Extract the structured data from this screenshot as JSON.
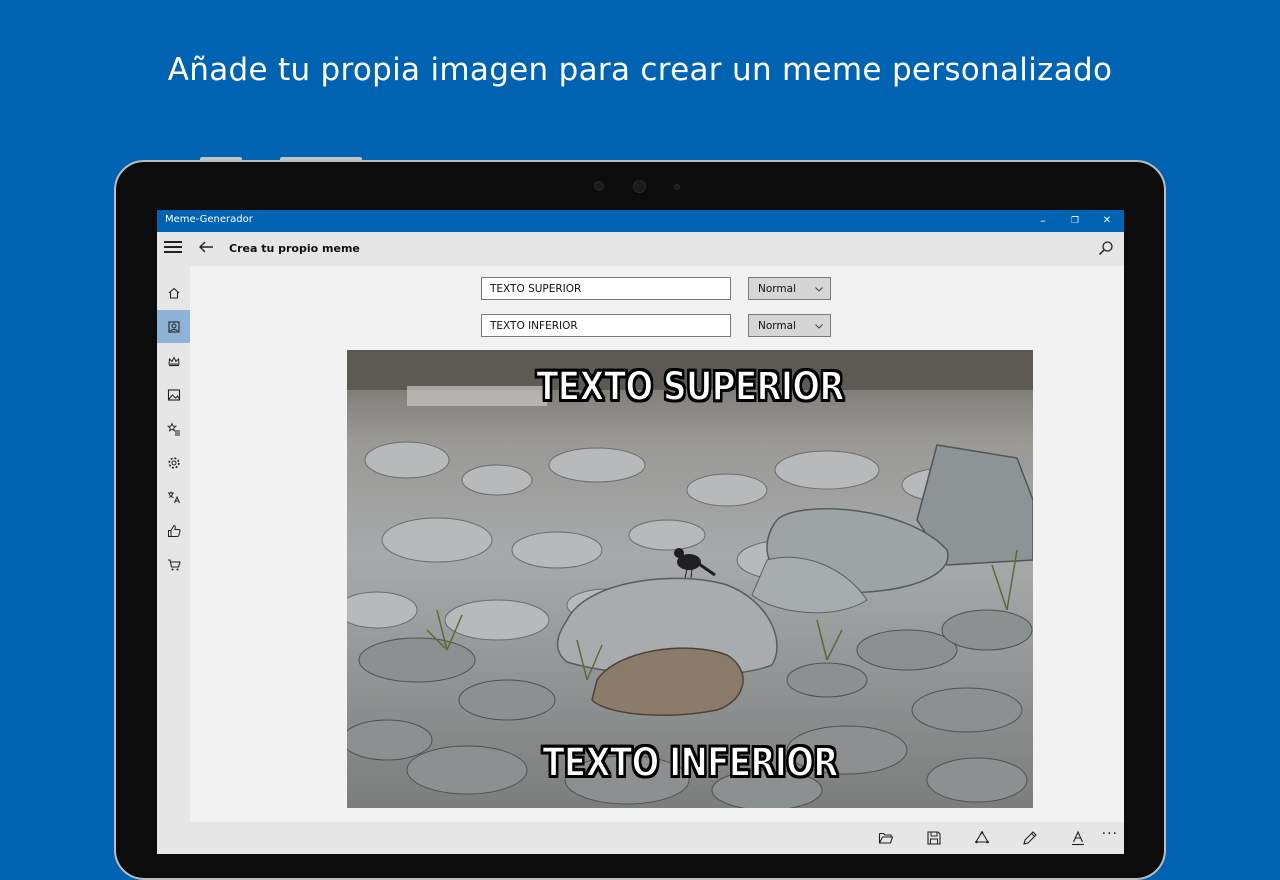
{
  "promo": {
    "headline": "Añade tu propia imagen para crear un meme personalizado"
  },
  "window": {
    "title": "Meme-Generador",
    "controls": {
      "minimize": "–",
      "restore": "❐",
      "close": "✕"
    }
  },
  "appbar": {
    "page_title": "Crea tu propio meme"
  },
  "sidebar": {
    "items": [
      {
        "icon": "home-icon",
        "active": false
      },
      {
        "icon": "meme-editor-icon",
        "active": true
      },
      {
        "icon": "crown-icon",
        "active": false
      },
      {
        "icon": "image-icon",
        "active": false
      },
      {
        "icon": "favorites-icon",
        "active": false
      },
      {
        "icon": "gear-icon",
        "active": false
      },
      {
        "icon": "language-icon",
        "active": false
      },
      {
        "icon": "thumbs-up-icon",
        "active": false
      },
      {
        "icon": "cart-icon",
        "active": false
      }
    ]
  },
  "editor": {
    "top_text_value": "TEXTO SUPERIOR",
    "bottom_text_value": "TEXTO INFERIOR",
    "top_style_value": "Normal",
    "bottom_style_value": "Normal"
  },
  "meme": {
    "top_caption": "TEXTO SUPERIOR",
    "bottom_caption": "TEXTO INFERIOR"
  },
  "toolbar": {
    "tools": [
      "open-folder-icon",
      "save-icon",
      "share-icon",
      "pencil-icon",
      "font-icon"
    ],
    "more": "···"
  },
  "colors": {
    "brand": "#0063b1",
    "sidebar_active": "#8fb3d6"
  }
}
